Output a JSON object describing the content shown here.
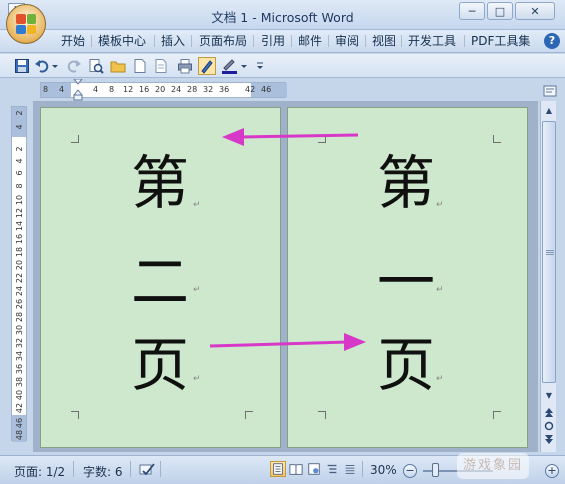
{
  "window": {
    "title": "文档 1 - Microsoft Word",
    "minimize": "─",
    "maximize": "□",
    "close": "✕"
  },
  "ribbon": {
    "tabs": [
      "开始",
      "模板中心",
      "插入",
      "页面布局",
      "引用",
      "邮件",
      "审阅",
      "视图",
      "开发工具",
      "PDF工具集"
    ],
    "help": "?"
  },
  "ruler": {
    "tab_stop_glyph": "L",
    "horizontal_ticks": [
      "8",
      "4",
      "4",
      "8",
      "12",
      "16",
      "20",
      "24",
      "28",
      "32",
      "36",
      "42",
      "46"
    ],
    "vertical_ticks": [
      "2",
      "4",
      "2",
      "4",
      "6",
      "8",
      "10",
      "12",
      "14",
      "16",
      "18",
      "20",
      "22",
      "24",
      "26",
      "28",
      "30",
      "32",
      "34",
      "36",
      "38",
      "40",
      "42",
      "46",
      "48"
    ]
  },
  "document": {
    "left_page": {
      "line1": "第",
      "line2": "二",
      "line3": "页"
    },
    "right_page": {
      "line1": "第",
      "line2": "一",
      "line3": "页"
    },
    "paragraph_mark": "↵",
    "page_color": "#cde8cd",
    "arrow_color": "#d838c8"
  },
  "status": {
    "page": "页面: 1/2",
    "words": "字数: 6",
    "zoom": "30%",
    "zoom_level_percent": 30,
    "zoom_out": "−",
    "zoom_in": "+"
  },
  "scrollbar": {
    "up": "▲",
    "down": "▼"
  },
  "watermark": "游戏象园"
}
